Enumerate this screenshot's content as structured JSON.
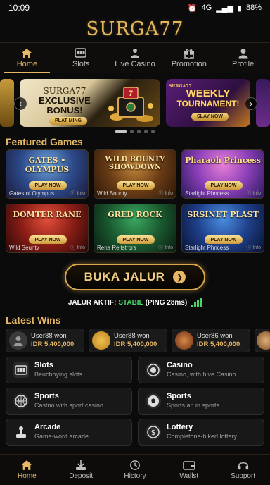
{
  "status_bar": {
    "time": "10:09",
    "network": "4G",
    "battery": "88%"
  },
  "brand": {
    "logo_text": "SURGA77"
  },
  "top_nav": [
    {
      "label": "Home",
      "icon": "home-icon",
      "active": true
    },
    {
      "label": "Slots",
      "icon": "slot-machine-icon",
      "active": false
    },
    {
      "label": "Live Casino",
      "icon": "dealer-icon",
      "active": false
    },
    {
      "label": "Promotion",
      "icon": "gift-icon",
      "active": false
    },
    {
      "label": "Profile",
      "icon": "user-icon",
      "active": false
    }
  ],
  "banners": {
    "bonus": {
      "brand": "SURGA77",
      "title_line1": "EXCLUSIVE",
      "title_line2": "BONUS!",
      "cta": "PLAT MING"
    },
    "tournament": {
      "brand": "SURGA77",
      "title_line1": "WEEKLY",
      "title_line2": "TOURNAMENT!",
      "cta": "SLAY NOW"
    }
  },
  "featured": {
    "title": "Featured Games",
    "play_label": "PLAY NOW",
    "games": [
      {
        "art_title": "GATES • OLYMPUS",
        "name": "Gates of Olympus",
        "info": "Info"
      },
      {
        "art_title": "WILD BOUNTY SHOWDOWN",
        "name": "Wild Bounty",
        "info": "Info"
      },
      {
        "art_title": "Pharaoh Princess",
        "name": "Starlight Phncess",
        "info": "Info"
      },
      {
        "art_title": "DOMTER RANE",
        "name": "Wild Seunty",
        "info": "Info"
      },
      {
        "art_title": "GRED ROCK",
        "name": "Rena Reltstrors",
        "info": "Info"
      },
      {
        "art_title": "SRSINET PLAST",
        "name": "Starlight Phncess",
        "info": "Info"
      }
    ]
  },
  "jalur": {
    "button_label": "BUKA JALUR",
    "status_prefix": "JALUR AKTIF:",
    "status_value": "STABIL",
    "ping": "(PING 28ms)"
  },
  "latest_wins": {
    "title": "Latest Wins",
    "items": [
      {
        "user": "User88 won",
        "amount": "IDR 5,400,000"
      },
      {
        "user": "User88 won",
        "amount": "IDR 5,400,000"
      },
      {
        "user": "User86 won",
        "amount": "IDR 5,400,000"
      }
    ]
  },
  "categories": [
    {
      "title": "Slots",
      "subtitle": "Beuchoying slots",
      "icon": "slot-icon"
    },
    {
      "title": "Casino",
      "subtitle": "Casino, with hive Casino",
      "icon": "chip-icon"
    },
    {
      "title": "Sports",
      "subtitle": "Castno with sport casino",
      "icon": "basketball-icon"
    },
    {
      "title": "Sports",
      "subtitle": "Sports an in sports",
      "icon": "soccer-ball-icon"
    },
    {
      "title": "Arcade",
      "subtitle": "Game-word arcade",
      "icon": "joystick-icon"
    },
    {
      "title": "Lottery",
      "subtitle": "Completone-hiked lottery",
      "icon": "lottery-icon"
    }
  ],
  "bottom_nav": [
    {
      "label": "Home",
      "icon": "home-icon",
      "active": true
    },
    {
      "label": "Deposit",
      "icon": "deposit-icon",
      "active": false
    },
    {
      "label": "Hictory",
      "icon": "history-icon",
      "active": false
    },
    {
      "label": "Wallst",
      "icon": "wallet-icon",
      "active": false
    },
    {
      "label": "Support",
      "icon": "headset-icon",
      "active": false
    }
  ],
  "colors": {
    "gold": "#e6b866",
    "background": "#0b0b0c",
    "stable_green": "#4bd66a"
  }
}
